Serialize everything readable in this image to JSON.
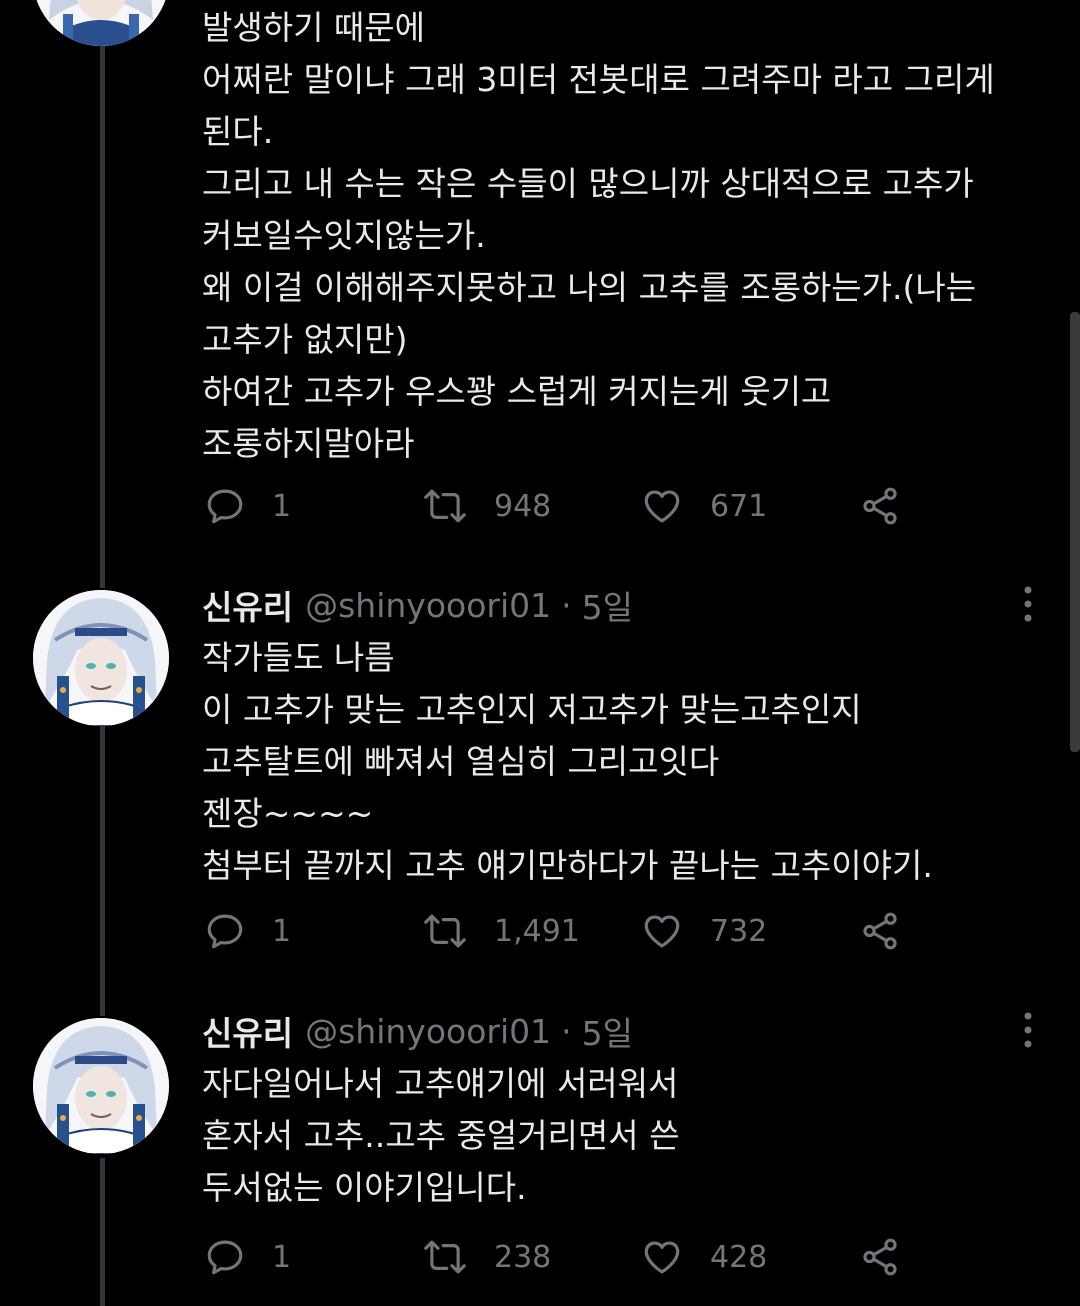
{
  "tweets": [
    {
      "body_lines": [
        "발생하기 때문에",
        "어쩌란 말이냐 그래 3미터 전봇대로 그려주마 라고 그리게",
        "된다.",
        "그리고 내 수는 작은 수들이 많으니까 상대적으로 고추가",
        "커보일수잇지않는가.",
        "왜 이걸 이해해주지못하고 나의 고추를 조롱하는가.(나는",
        "고추가 없지만)",
        "하여간 고추가 우스꽝 스럽게 커지는게 웃기고",
        "조롱하지말아라"
      ],
      "replies": "1",
      "retweets": "948",
      "likes": "671"
    },
    {
      "name": "신유리",
      "handle": "@shinyooori01",
      "separator": "·",
      "time": "5일",
      "body_lines": [
        "작가들도 나름",
        "이 고추가 맞는 고추인지 저고추가 맞는고추인지",
        "고추탈트에 빠져서 열심히 그리고잇다",
        "젠장~~~~",
        "첨부터 끝까지 고추 얘기만하다가 끝나는 고추이야기."
      ],
      "replies": "1",
      "retweets": "1,491",
      "likes": "732"
    },
    {
      "name": "신유리",
      "handle": "@shinyooori01",
      "separator": "·",
      "time": "5일",
      "body_lines": [
        "자다일어나서 고추얘기에 서러워서",
        "혼자서 고추..고추 중얼거리면서 쓴",
        "두서없는 이야기입니다."
      ],
      "replies": "1",
      "retweets": "238",
      "likes": "428"
    }
  ],
  "icons": {
    "reply": "reply-icon",
    "retweet": "retweet-icon",
    "like": "heart-icon",
    "share": "share-icon",
    "more": "more-vertical-icon"
  },
  "colors": {
    "background": "#000000",
    "text": "#e7e9ea",
    "secondary": "#71767b",
    "thread_line": "#333639"
  }
}
